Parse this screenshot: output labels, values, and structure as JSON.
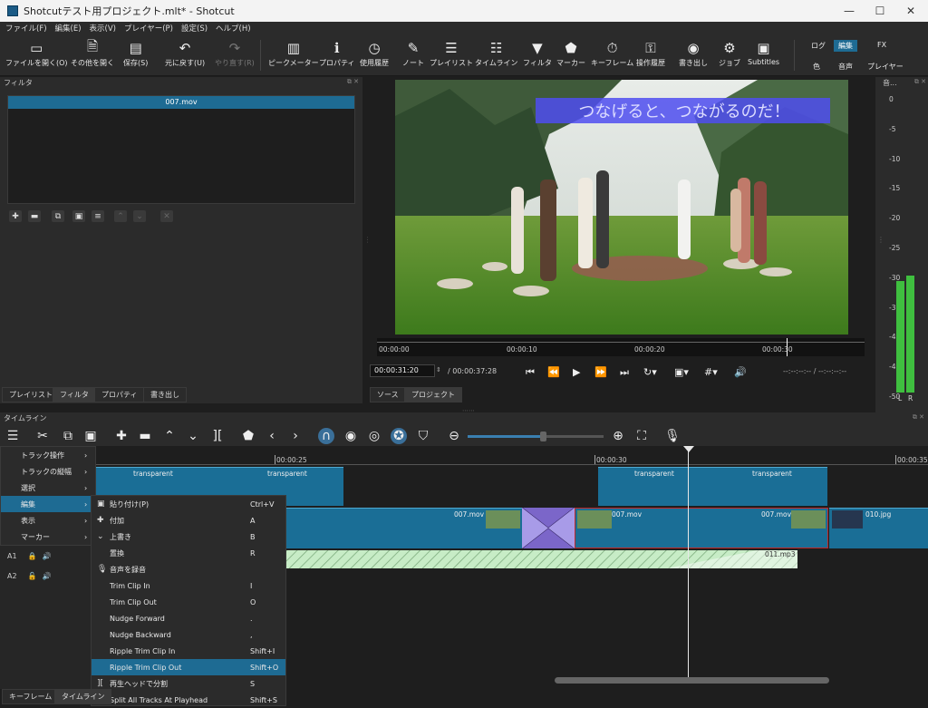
{
  "window": {
    "title": "Shotcutテスト用プロジェクト.mlt* - Shotcut",
    "minimize": "—",
    "maximize": "☐",
    "close": "✕"
  },
  "menubar": [
    "ファイル(F)",
    "編集(E)",
    "表示(V)",
    "プレイヤー(P)",
    "設定(S)",
    "ヘルプ(H)"
  ],
  "toolbar": {
    "items": [
      {
        "label": "ファイルを開く(O)",
        "icon": "folder-open-icon",
        "glyph": "▭"
      },
      {
        "label": "その他を開く",
        "icon": "open-other-icon",
        "glyph": "🗎"
      },
      {
        "label": "保存(S)",
        "icon": "save-icon",
        "glyph": "💾"
      },
      {
        "label": "元に戻す(U)",
        "icon": "undo-icon",
        "glyph": "↶"
      },
      {
        "label": "やり直す(R)",
        "icon": "redo-icon",
        "glyph": "↷"
      },
      {
        "label": "ピークメーター",
        "icon": "peak-meter-icon",
        "glyph": "▥"
      },
      {
        "label": "プロパティ",
        "icon": "properties-icon",
        "glyph": "ℹ"
      },
      {
        "label": "使用履歴",
        "icon": "history-icon",
        "glyph": "◷"
      },
      {
        "label": "ノート",
        "icon": "notes-icon",
        "glyph": "✎"
      },
      {
        "label": "プレイリスト",
        "icon": "playlist-icon",
        "glyph": "☰"
      },
      {
        "label": "タイムライン",
        "icon": "timeline-icon",
        "glyph": "☷"
      },
      {
        "label": "フィルタ",
        "icon": "filter-icon",
        "glyph": "▼"
      },
      {
        "label": "マーカー",
        "icon": "marker-icon",
        "glyph": "⬟"
      },
      {
        "label": "キーフレーム",
        "icon": "keyframe-icon",
        "glyph": "⏱"
      },
      {
        "label": "操作履歴",
        "icon": "action-history-icon",
        "glyph": "⚿"
      },
      {
        "label": "書き出し",
        "icon": "export-icon",
        "glyph": "◉"
      },
      {
        "label": "ジョブ",
        "icon": "jobs-icon",
        "glyph": "⚙"
      },
      {
        "label": "Subtitles",
        "icon": "subtitles-icon",
        "glyph": "▣"
      }
    ],
    "layouts": [
      {
        "label": "ログ"
      },
      {
        "label": "編集"
      },
      {
        "label": "FX"
      },
      {
        "label": "色"
      },
      {
        "label": "音声"
      },
      {
        "label": "プレイヤー"
      }
    ]
  },
  "filters_panel": {
    "title": "フィルタ",
    "clip_name": "007.mov",
    "tabs": [
      "プレイリスト",
      "フィルタ",
      "プロパティ",
      "書き出し"
    ]
  },
  "player": {
    "overlay_text": "つなげると、つながるのだ！",
    "ruler": [
      "00:00:00",
      "00:00:10",
      "00:00:20",
      "00:00:30"
    ],
    "position": "00:00:31:20",
    "duration": "/ 00:00:37:28",
    "in_out": "--:--:--:-- / --:--:--:--",
    "tabs": [
      "ソース",
      "プロジェクト"
    ],
    "playhead_fraction": 0.84
  },
  "audio_meter": {
    "title": "音...",
    "scale": [
      "0",
      "-5",
      "-10",
      "-15",
      "-20",
      "-25",
      "-30",
      "-35",
      "-40",
      "-45",
      "-50"
    ],
    "channels": [
      "L",
      "R"
    ],
    "level_db": -31
  },
  "timeline": {
    "title": "タイムライン",
    "ruler": [
      "00:00:25",
      "00:00:30",
      "00:00:35"
    ],
    "tracks": [
      {
        "name": "A1",
        "lock": "🔒",
        "audio": "🔊"
      },
      {
        "name": "A2",
        "lock": "🔓",
        "audio": "🔊"
      }
    ],
    "clips": {
      "top_left": [
        "transparent",
        "transparent"
      ],
      "top_right": [
        "transparent",
        "transparent"
      ],
      "v1_a": "007.mov",
      "v1_b1": "007.mov",
      "v1_b2": "007.mov",
      "v1_c": "010.jpg",
      "a1": "011.mp3"
    },
    "zoom_level": 0.55
  },
  "track_menu": {
    "items": [
      "トラック操作",
      "トラックの縦幅",
      "選択",
      "編集",
      "表示",
      "マーカー"
    ]
  },
  "edit_submenu": {
    "items": [
      {
        "icon": "paste-icon",
        "glyph": "▣",
        "label": "貼り付け(P)",
        "shortcut": "Ctrl+V"
      },
      {
        "icon": "append-icon",
        "glyph": "✚",
        "label": "付加",
        "shortcut": "A"
      },
      {
        "icon": "overwrite-icon",
        "glyph": "⌄",
        "label": "上書き",
        "shortcut": "B"
      },
      {
        "icon": "",
        "glyph": "",
        "label": "置換",
        "shortcut": "R"
      },
      {
        "icon": "microphone-icon",
        "glyph": "🎙",
        "label": "音声を録音",
        "shortcut": ""
      },
      {
        "icon": "",
        "glyph": "",
        "label": "Trim Clip In",
        "shortcut": "I"
      },
      {
        "icon": "",
        "glyph": "",
        "label": "Trim Clip Out",
        "shortcut": "O"
      },
      {
        "icon": "",
        "glyph": "",
        "label": "Nudge Forward",
        "shortcut": "."
      },
      {
        "icon": "",
        "glyph": "",
        "label": "Nudge Backward",
        "shortcut": ","
      },
      {
        "icon": "",
        "glyph": "",
        "label": "Ripple Trim Clip In",
        "shortcut": "Shift+I"
      },
      {
        "icon": "",
        "glyph": "",
        "label": "Ripple Trim Clip Out",
        "shortcut": "Shift+O"
      },
      {
        "icon": "split-icon",
        "glyph": "][",
        "label": "再生ヘッドで分割",
        "shortcut": "S"
      },
      {
        "icon": "",
        "glyph": "",
        "label": "Split All Tracks At Playhead",
        "shortcut": "Shift+S"
      }
    ]
  },
  "bottom_tabs": [
    "キーフレーム",
    "タイムライン"
  ]
}
